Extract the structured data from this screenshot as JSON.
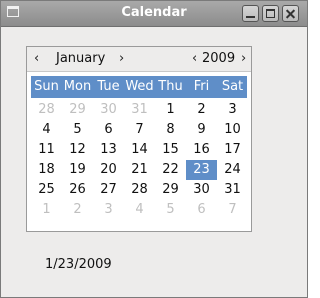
{
  "window": {
    "title": "Calendar"
  },
  "calendar": {
    "month": "January",
    "year": "2009",
    "prev_month": "‹",
    "next_month": "›",
    "prev_year": "‹",
    "next_year": "›",
    "weekdays": [
      "Sun",
      "Mon",
      "Tue",
      "Wed",
      "Thu",
      "Fri",
      "Sat"
    ],
    "weeks": [
      [
        "28",
        "29",
        "30",
        "31",
        "1",
        "2",
        "3"
      ],
      [
        "4",
        "5",
        "6",
        "7",
        "8",
        "9",
        "10"
      ],
      [
        "11",
        "12",
        "13",
        "14",
        "15",
        "16",
        "17"
      ],
      [
        "18",
        "19",
        "20",
        "21",
        "22",
        "23",
        "24"
      ],
      [
        "25",
        "26",
        "27",
        "28",
        "29",
        "30",
        "31"
      ],
      [
        "1",
        "2",
        "3",
        "4",
        "5",
        "6",
        "7"
      ]
    ],
    "selected_day": "23",
    "accent_color": "#5f8ec8"
  },
  "selected_date_label": "1/23/2009"
}
